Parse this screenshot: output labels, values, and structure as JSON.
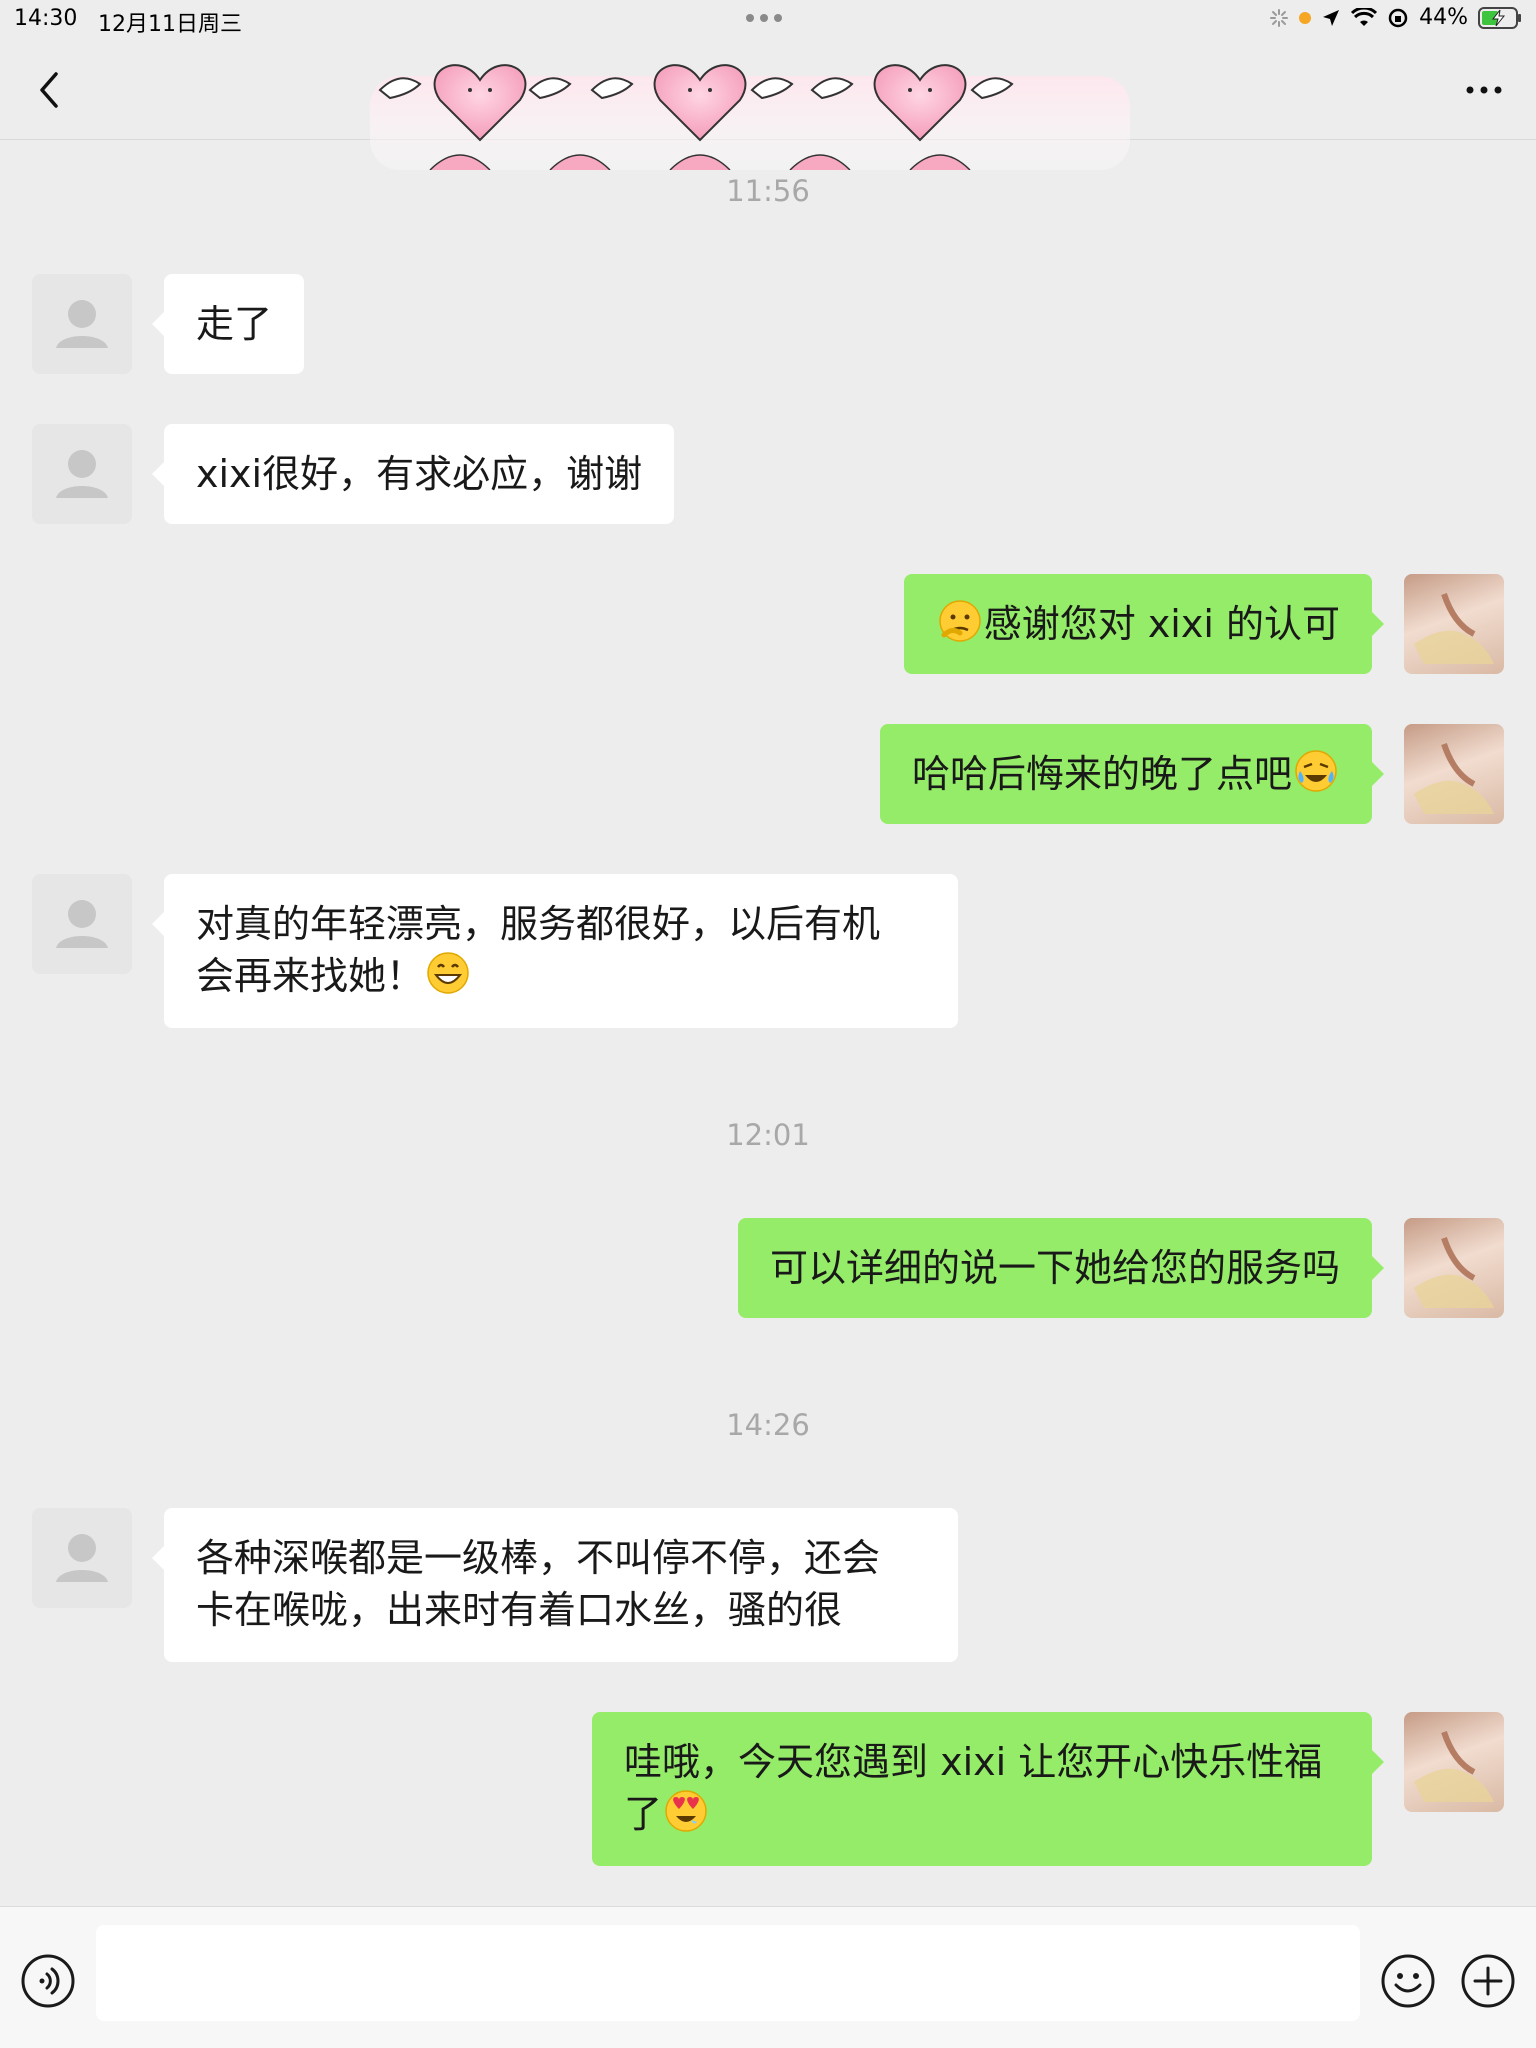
{
  "status_bar": {
    "time": "14:30",
    "date": "12月11日周三",
    "battery": "44%"
  },
  "nav": {
    "back_icon": "chevron-left-icon",
    "more_icon": "ellipsis-icon",
    "title_art": "winged-hearts-banner"
  },
  "timestamps": [
    "11:56",
    "12:01",
    "14:26"
  ],
  "messages": [
    {
      "side": "in",
      "text": "走了"
    },
    {
      "side": "in",
      "text": "xixi很好，有求必应，谢谢"
    },
    {
      "side": "out",
      "emoji": "thinking-face",
      "text": "感谢您对 xixi 的认可"
    },
    {
      "side": "out",
      "text": "哈哈后悔来的晚了点吧",
      "emoji": "crying-laughing-face"
    },
    {
      "side": "in",
      "line1": "对真的年轻漂亮，服务都很好，以后有机",
      "line2": "会再来找她！",
      "emoji": "grinning-face"
    },
    {
      "side": "out",
      "text": "可以详细的说一下她给您的服务吗"
    },
    {
      "side": "in",
      "line1": "各种深喉都是一级棒，不叫停不停，还会",
      "line2": "卡在喉咙，出来时有着口水丝，骚的很"
    },
    {
      "side": "out",
      "line1": "哇哦，今天您遇到 xixi 让您开心快乐性福",
      "line2": "了",
      "emoji": "heart-eyes-face"
    }
  ],
  "input_bar": {
    "voice_icon": "voice-icon",
    "emoji_icon": "emoji-icon",
    "plus_icon": "plus-icon",
    "value": ""
  },
  "colors": {
    "background": "#ededed",
    "outgoing_bubble": "#95ec69",
    "incoming_bubble": "#ffffff",
    "timestamp": "#a8a8a8"
  }
}
